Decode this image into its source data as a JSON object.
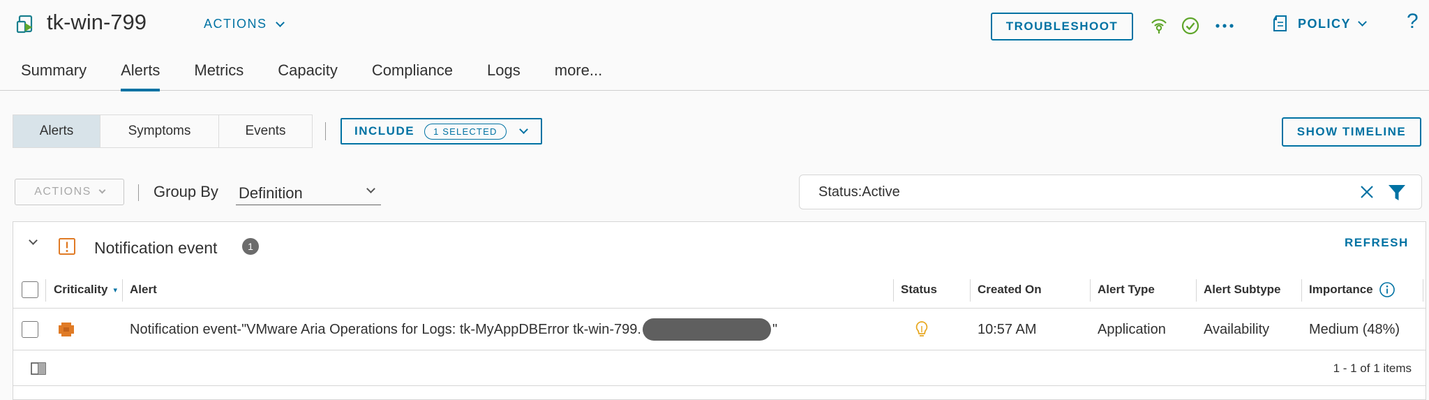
{
  "header": {
    "object_name": "tk-win-799",
    "actions_label": "ACTIONS",
    "troubleshoot_label": "TROUBLESHOOT",
    "policy_label": "POLICY",
    "help_label": "?"
  },
  "tabs": [
    {
      "label": "Summary",
      "active": false
    },
    {
      "label": "Alerts",
      "active": true
    },
    {
      "label": "Metrics",
      "active": false
    },
    {
      "label": "Capacity",
      "active": false
    },
    {
      "label": "Compliance",
      "active": false
    },
    {
      "label": "Logs",
      "active": false
    },
    {
      "label": "more...",
      "active": false
    }
  ],
  "subnav": {
    "segments": [
      {
        "label": "Alerts",
        "active": true
      },
      {
        "label": "Symptoms",
        "active": false
      },
      {
        "label": "Events",
        "active": false
      }
    ],
    "include_label": "INCLUDE",
    "include_badge": "1 SELECTED",
    "show_timeline_label": "SHOW TIMELINE"
  },
  "toolbar": {
    "actions_label": "ACTIONS",
    "group_by_label": "Group By",
    "group_by_value": "Definition",
    "filter_value": "Status:Active"
  },
  "group": {
    "title": "Notification event",
    "count": "1",
    "refresh_label": "REFRESH"
  },
  "table": {
    "columns": [
      "Criticality",
      "Alert",
      "Status",
      "Created On",
      "Alert Type",
      "Alert Subtype",
      "Importance"
    ],
    "rows": [
      {
        "alert_prefix": "Notification event-\"VMware Aria Operations for Logs: tk-MyAppDBError tk-win-799.",
        "alert_suffix": "\"",
        "created_on": "10:57 AM",
        "alert_type": "Application",
        "alert_subtype": "Availability",
        "importance": "Medium (48%)"
      }
    ],
    "pager": "1 - 1 of 1 items"
  },
  "colors": {
    "accent": "#0072a3",
    "criticality": "#e07b26",
    "status_icon": "#e8a820",
    "health_green": "#5fa62b"
  }
}
